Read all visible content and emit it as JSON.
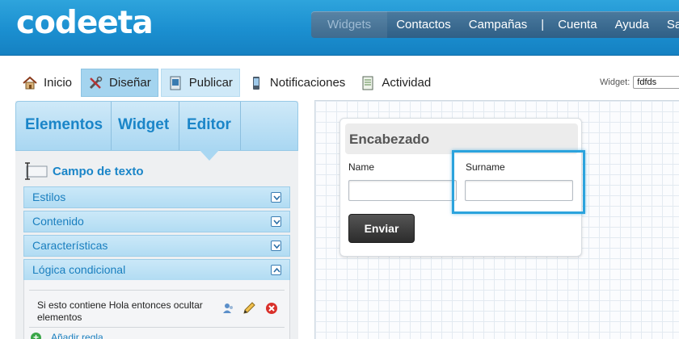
{
  "app": {
    "logo": "codeeta"
  },
  "topnav": {
    "items": [
      "Widgets",
      "Contactos",
      "Campañas",
      "Cuenta",
      "Ayuda",
      "Sali"
    ],
    "separator": "|"
  },
  "subnav": {
    "items": [
      "Inicio",
      "Diseñar",
      "Publicar",
      "Notificaciones",
      "Actividad"
    ],
    "widget_label": "Widget:",
    "widget_value": "fdfds"
  },
  "panel": {
    "tabs": [
      "Elementos",
      "Widget",
      "Editor"
    ],
    "field_title": "Campo de texto",
    "sections": [
      "Estilos",
      "Contenido",
      "Características",
      "Lógica condicional"
    ],
    "rule_text": "Si esto contiene Hola entonces ocultar elementos",
    "add_rule": "Añadir regla"
  },
  "form": {
    "header": "Encabezado",
    "name_label": "Name",
    "surname_label": "Surname",
    "submit_label": "Enviar"
  },
  "colors": {
    "brand_blue": "#1b8fd0",
    "accent": "#1a85c8",
    "selection": "#2ba3dd"
  },
  "icons": [
    "house-icon",
    "tools-icon",
    "publish-icon",
    "phone-icon",
    "activity-icon",
    "textfield-icon",
    "user-icon",
    "pencil-icon",
    "delete-icon",
    "plus-icon",
    "chevron-down-icon",
    "chevron-up-icon"
  ]
}
